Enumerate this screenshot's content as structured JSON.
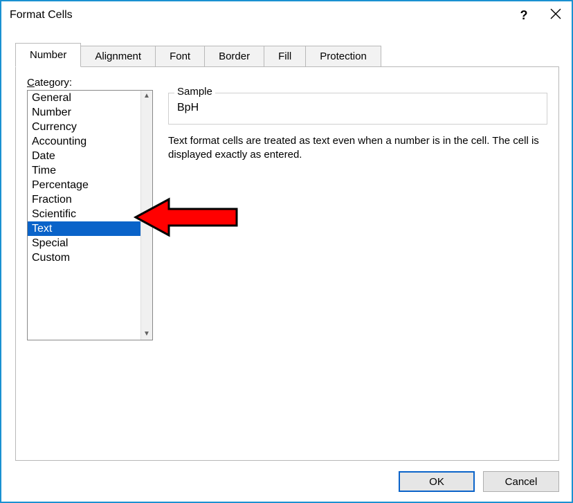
{
  "title": "Format Cells",
  "tabs": [
    {
      "label": "Number",
      "active": true
    },
    {
      "label": "Alignment",
      "active": false
    },
    {
      "label": "Font",
      "active": false
    },
    {
      "label": "Border",
      "active": false
    },
    {
      "label": "Fill",
      "active": false
    },
    {
      "label": "Protection",
      "active": false
    }
  ],
  "category_label_prefix": "C",
  "category_label_rest": "ategory:",
  "categories": [
    {
      "label": "General",
      "selected": false
    },
    {
      "label": "Number",
      "selected": false
    },
    {
      "label": "Currency",
      "selected": false
    },
    {
      "label": "Accounting",
      "selected": false
    },
    {
      "label": "Date",
      "selected": false
    },
    {
      "label": "Time",
      "selected": false
    },
    {
      "label": "Percentage",
      "selected": false
    },
    {
      "label": "Fraction",
      "selected": false
    },
    {
      "label": "Scientific",
      "selected": false
    },
    {
      "label": "Text",
      "selected": true
    },
    {
      "label": "Special",
      "selected": false
    },
    {
      "label": "Custom",
      "selected": false
    }
  ],
  "sample_legend": "Sample",
  "sample_value": "BpH",
  "description": "Text format cells are treated as text even when a number is in the cell. The cell is displayed exactly as entered.",
  "buttons": {
    "ok": "OK",
    "cancel": "Cancel"
  },
  "help_glyph": "?",
  "scroll_up_glyph": "▲",
  "scroll_down_glyph": "▼"
}
